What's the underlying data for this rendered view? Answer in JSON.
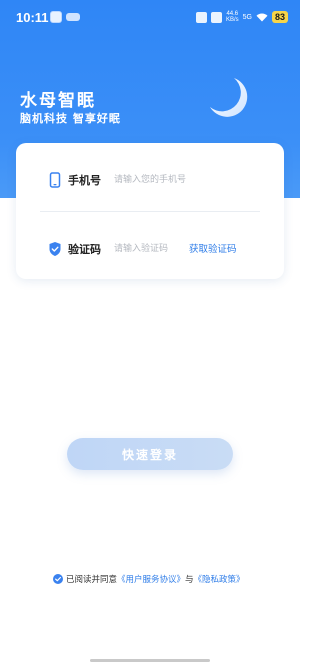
{
  "status_bar": {
    "time": "10:11",
    "net_speed_top": "44.6",
    "net_speed_bottom": "KB/s",
    "network": "5G",
    "battery": "83"
  },
  "brand": {
    "title": "水母智眠",
    "subtitle": "脑机科技 智享好眠"
  },
  "form": {
    "phone": {
      "label": "手机号",
      "placeholder": "请输入您的手机号",
      "value": ""
    },
    "code": {
      "label": "验证码",
      "placeholder": "请输入验证码",
      "value": "",
      "get_code": "获取验证码"
    }
  },
  "login_button": "快速登录",
  "agreement": {
    "prefix": "已阅读并同意",
    "user_agreement": "《用户服务协议》",
    "conjunction": "与",
    "privacy": "《隐私政策》",
    "checked": true
  },
  "colors": {
    "primary": "#2f86f6",
    "link": "#2f7de8",
    "button_disabled": "#c4d9f5"
  }
}
